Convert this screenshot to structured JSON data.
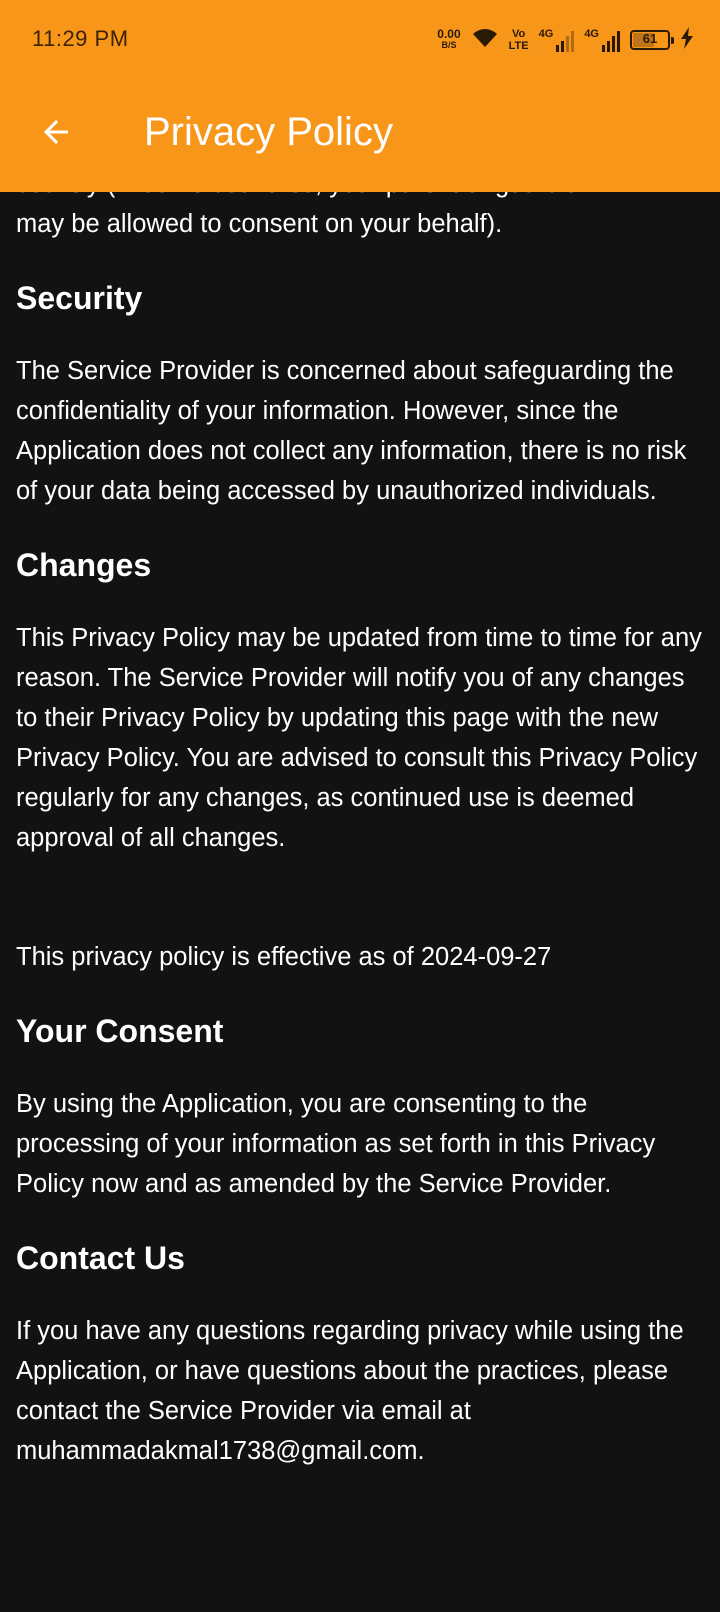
{
  "status_bar": {
    "time": "11:29 PM",
    "net_speed_value": "0.00",
    "net_speed_unit": "B/S",
    "volte_top": "Vo",
    "volte_bottom": "LTE",
    "sim1_label": "4G",
    "sim2_label": "4G",
    "battery_percent": "61",
    "battery_level": 0.61,
    "icons": [
      "wifi-icon",
      "signal-icon",
      "battery-icon",
      "charging-icon"
    ]
  },
  "app_bar": {
    "title": "Privacy Policy",
    "back_icon": "arrow-back-icon",
    "color": "#f8961a"
  },
  "content": {
    "partial_top_line": "country (in some countries, your parent or guardian",
    "partial_second_line": "may be allowed to consent on your behalf).",
    "sections": [
      {
        "heading": "Security",
        "body": "The Service Provider is concerned about safeguarding the confidentiality of your information. However, since the Application does not collect any information, there is no risk of your data being accessed by unauthorized individuals."
      },
      {
        "heading": "Changes",
        "body": "This Privacy Policy may be updated from time to time for any reason. The Service Provider will notify you of any changes to their Privacy Policy by updating this page with the new Privacy Policy. You are advised to consult this Privacy Policy regularly for any changes, as continued use is deemed approval of all changes."
      },
      {
        "effective": "This privacy policy is effective as of 2024-09-27"
      },
      {
        "heading": "Your Consent",
        "body": "By using the Application, you are consenting to the processing of your information as set forth in this Privacy Policy now and as amended by the Service Provider."
      },
      {
        "heading": "Contact Us",
        "body": "If you have any questions regarding privacy while using the Application, or have questions about the practices, please contact the Service Provider via email at muhammadakmal1738@gmail.com."
      }
    ]
  },
  "colors": {
    "background": "#121212",
    "text": "#ffffff",
    "accent": "#f8961a"
  }
}
